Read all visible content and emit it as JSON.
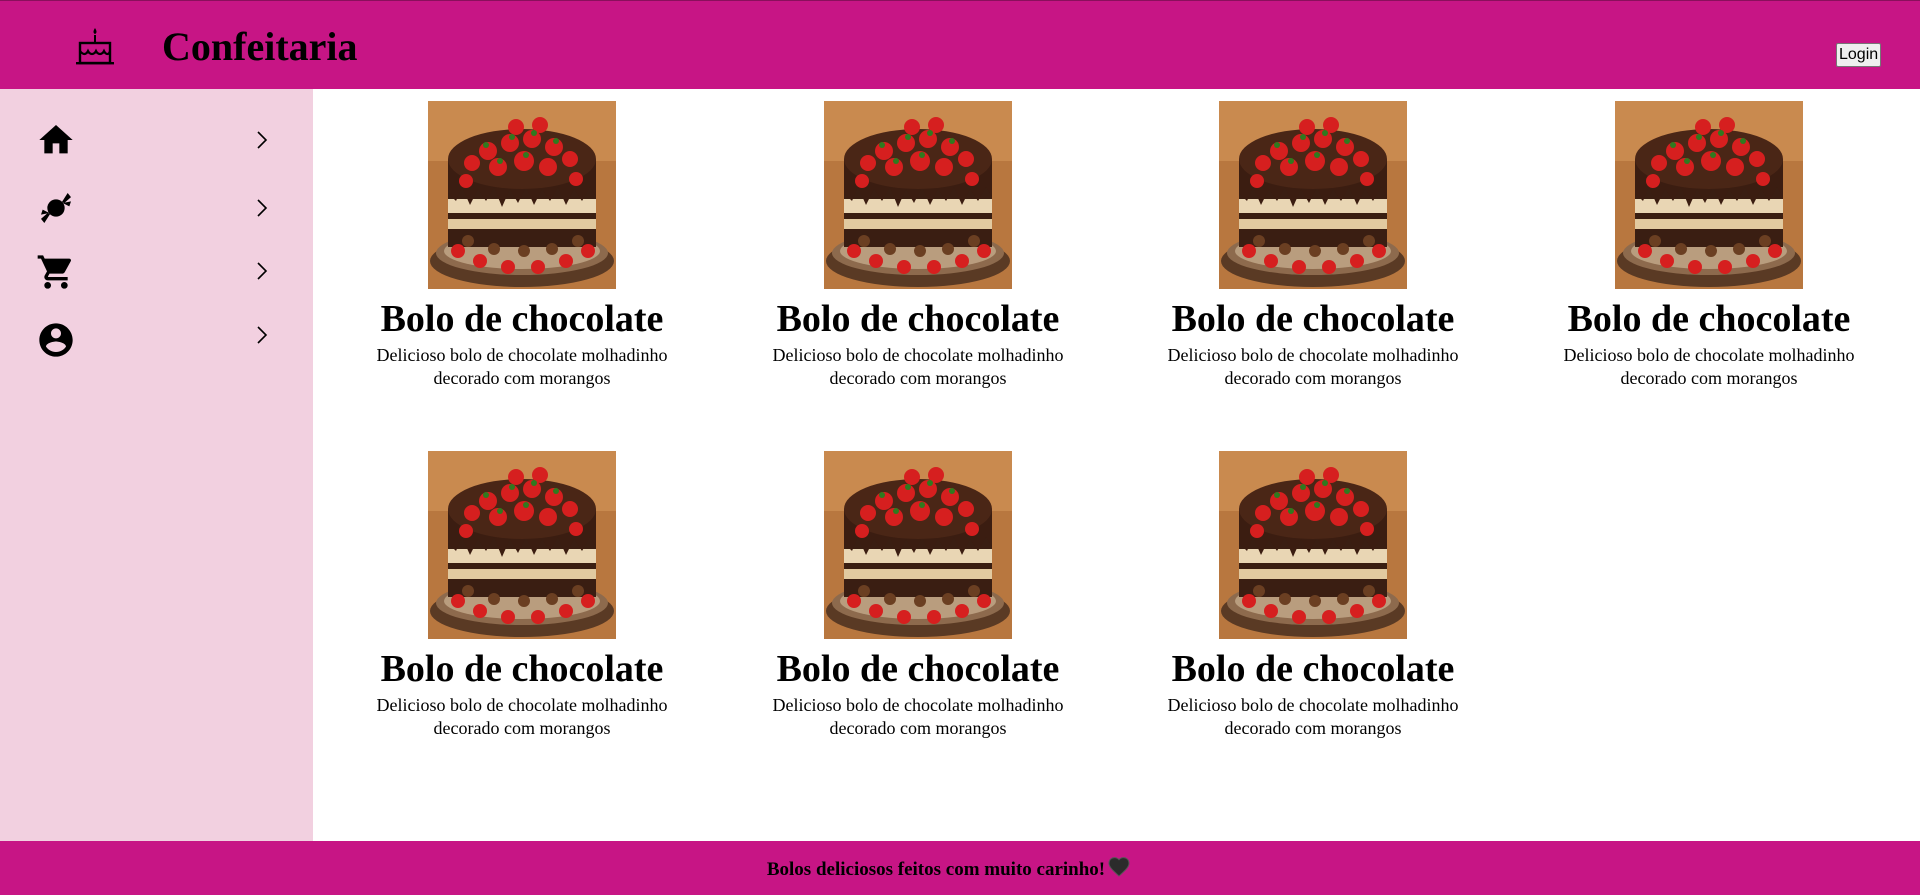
{
  "header": {
    "logo_icon": "cake-icon",
    "title": "Confeitaria",
    "login_label": "Login"
  },
  "sidebar": {
    "items": [
      {
        "icon": "home-icon",
        "chevron": "chevron-right-icon"
      },
      {
        "icon": "candy-icon",
        "chevron": "chevron-right-icon"
      },
      {
        "icon": "shopping-cart-icon",
        "chevron": "chevron-right-icon"
      },
      {
        "icon": "account-circle-icon",
        "chevron": "chevron-right-icon"
      }
    ]
  },
  "products": [
    {
      "name": "Bolo de chocolate",
      "description": "Delicioso bolo de chocolate molhadinho decorado com morangos",
      "image": "chocolate-cake-image"
    },
    {
      "name": "Bolo de chocolate",
      "description": "Delicioso bolo de chocolate molhadinho decorado com morangos",
      "image": "chocolate-cake-image"
    },
    {
      "name": "Bolo de chocolate",
      "description": "Delicioso bolo de chocolate molhadinho decorado com morangos",
      "image": "chocolate-cake-image"
    },
    {
      "name": "Bolo de chocolate",
      "description": "Delicioso bolo de chocolate molhadinho decorado com morangos",
      "image": "chocolate-cake-image"
    },
    {
      "name": "Bolo de chocolate",
      "description": "Delicioso bolo de chocolate molhadinho decorado com morangos",
      "image": "chocolate-cake-image"
    },
    {
      "name": "Bolo de chocolate",
      "description": "Delicioso bolo de chocolate molhadinho decorado com morangos",
      "image": "chocolate-cake-image"
    },
    {
      "name": "Bolo de chocolate",
      "description": "Delicioso bolo de chocolate molhadinho decorado com morangos",
      "image": "chocolate-cake-image"
    }
  ],
  "footer": {
    "message": "Bolos deliciosos feitos com muito carinho!",
    "icon": "black-heart-icon"
  },
  "colors": {
    "brand": "#c71585",
    "sidebar_bg": "#f2d0e0"
  }
}
